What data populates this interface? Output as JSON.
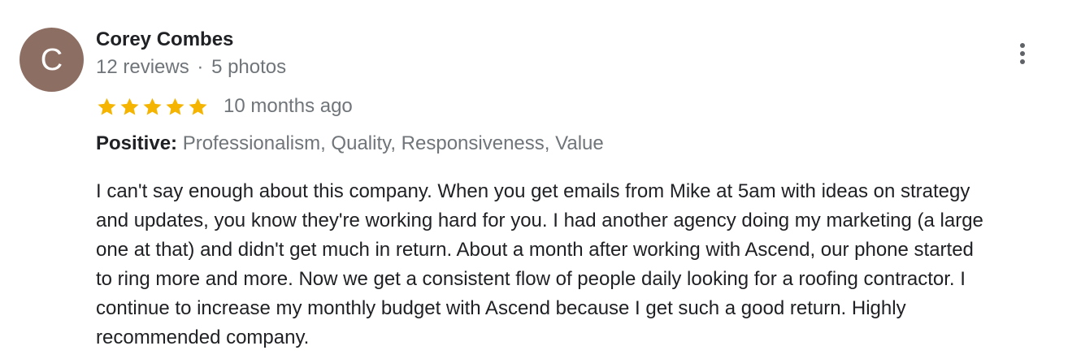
{
  "reviewer": {
    "initial": "C",
    "name": "Corey Combes",
    "reviews": "12 reviews",
    "separator": "·",
    "photos": "5 photos",
    "avatar_color": "#8d6e63"
  },
  "rating": {
    "stars": 5,
    "max": 5,
    "star_color": "#f4b400",
    "age": "10 months ago"
  },
  "attributes": {
    "label": "Positive:",
    "values": "Professionalism, Quality, Responsiveness, Value"
  },
  "review_text": {
    "lines": [
      "I can't say enough about this company. When you get emails from Mike at 5am with ideas on strategy",
      "and updates, you know they're working hard for you. I had another agency doing my marketing (a large",
      "one at that) and didn't get much in return. About a month after working with Ascend, our phone started",
      "to ring more and more. Now we get a consistent flow of people daily looking for a roofing contractor. I",
      "continue to increase my monthly budget with Ascend because I get such a good return. Highly",
      "recommended company."
    ]
  },
  "menu": {
    "icon": "more-vert-icon"
  }
}
